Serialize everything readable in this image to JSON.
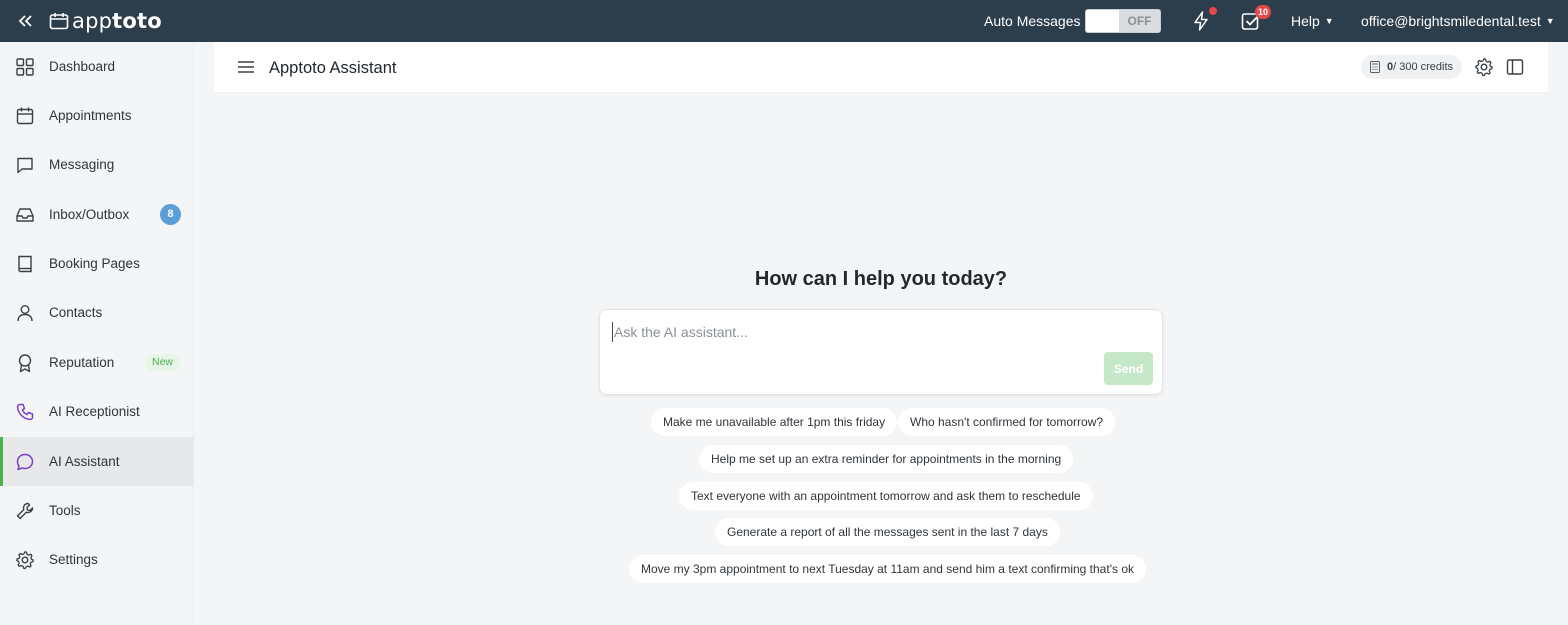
{
  "topbar": {
    "logo_text": "apptoto",
    "auto_messages_label": "Auto Messages",
    "toggle_state": "OFF",
    "tasks_badge": "10",
    "help_label": "Help",
    "account_email": "office@brightsmiledental.test"
  },
  "sidebar": {
    "items": [
      {
        "label": "Dashboard",
        "icon": "dashboard-icon"
      },
      {
        "label": "Appointments",
        "icon": "calendar-icon"
      },
      {
        "label": "Messaging",
        "icon": "chat-bubble-icon"
      },
      {
        "label": "Inbox/Outbox",
        "icon": "inbox-icon",
        "badge": "8"
      },
      {
        "label": "Booking Pages",
        "icon": "book-icon"
      },
      {
        "label": "Contacts",
        "icon": "user-icon"
      },
      {
        "label": "Reputation",
        "icon": "award-icon",
        "tag": "New"
      },
      {
        "label": "AI Receptionist",
        "icon": "phone-icon"
      },
      {
        "label": "AI Assistant",
        "icon": "ai-chat-icon",
        "active": true
      },
      {
        "label": "Tools",
        "icon": "wrench-icon"
      },
      {
        "label": "Settings",
        "icon": "gear-icon"
      }
    ]
  },
  "header": {
    "title": "Apptoto Assistant",
    "credits_used": "0",
    "credits_total_label": " / 300 credits"
  },
  "assistant": {
    "heading": "How can I help you today?",
    "input_placeholder": "Ask the AI assistant...",
    "send_label": "Send",
    "suggestions": [
      "Make me unavailable after 1pm this friday",
      "Who hasn't confirmed for tomorrow?",
      "Help me set up an extra reminder for appointments in the morning",
      "Text everyone with an appointment tomorrow and ask them to reschedule",
      "Generate a report of all the messages sent in the last 7 days",
      "Move my 3pm appointment to next Tuesday at 11am and send him a text confirming that's ok"
    ]
  },
  "colors": {
    "topbar_bg": "#2c3d4b",
    "active_accent": "#4caf50",
    "badge_blue": "#5a9fd8",
    "alert_red": "#e24a4a",
    "send_disabled": "#c5e8c8",
    "ai_accent": "#7b3fc4"
  }
}
